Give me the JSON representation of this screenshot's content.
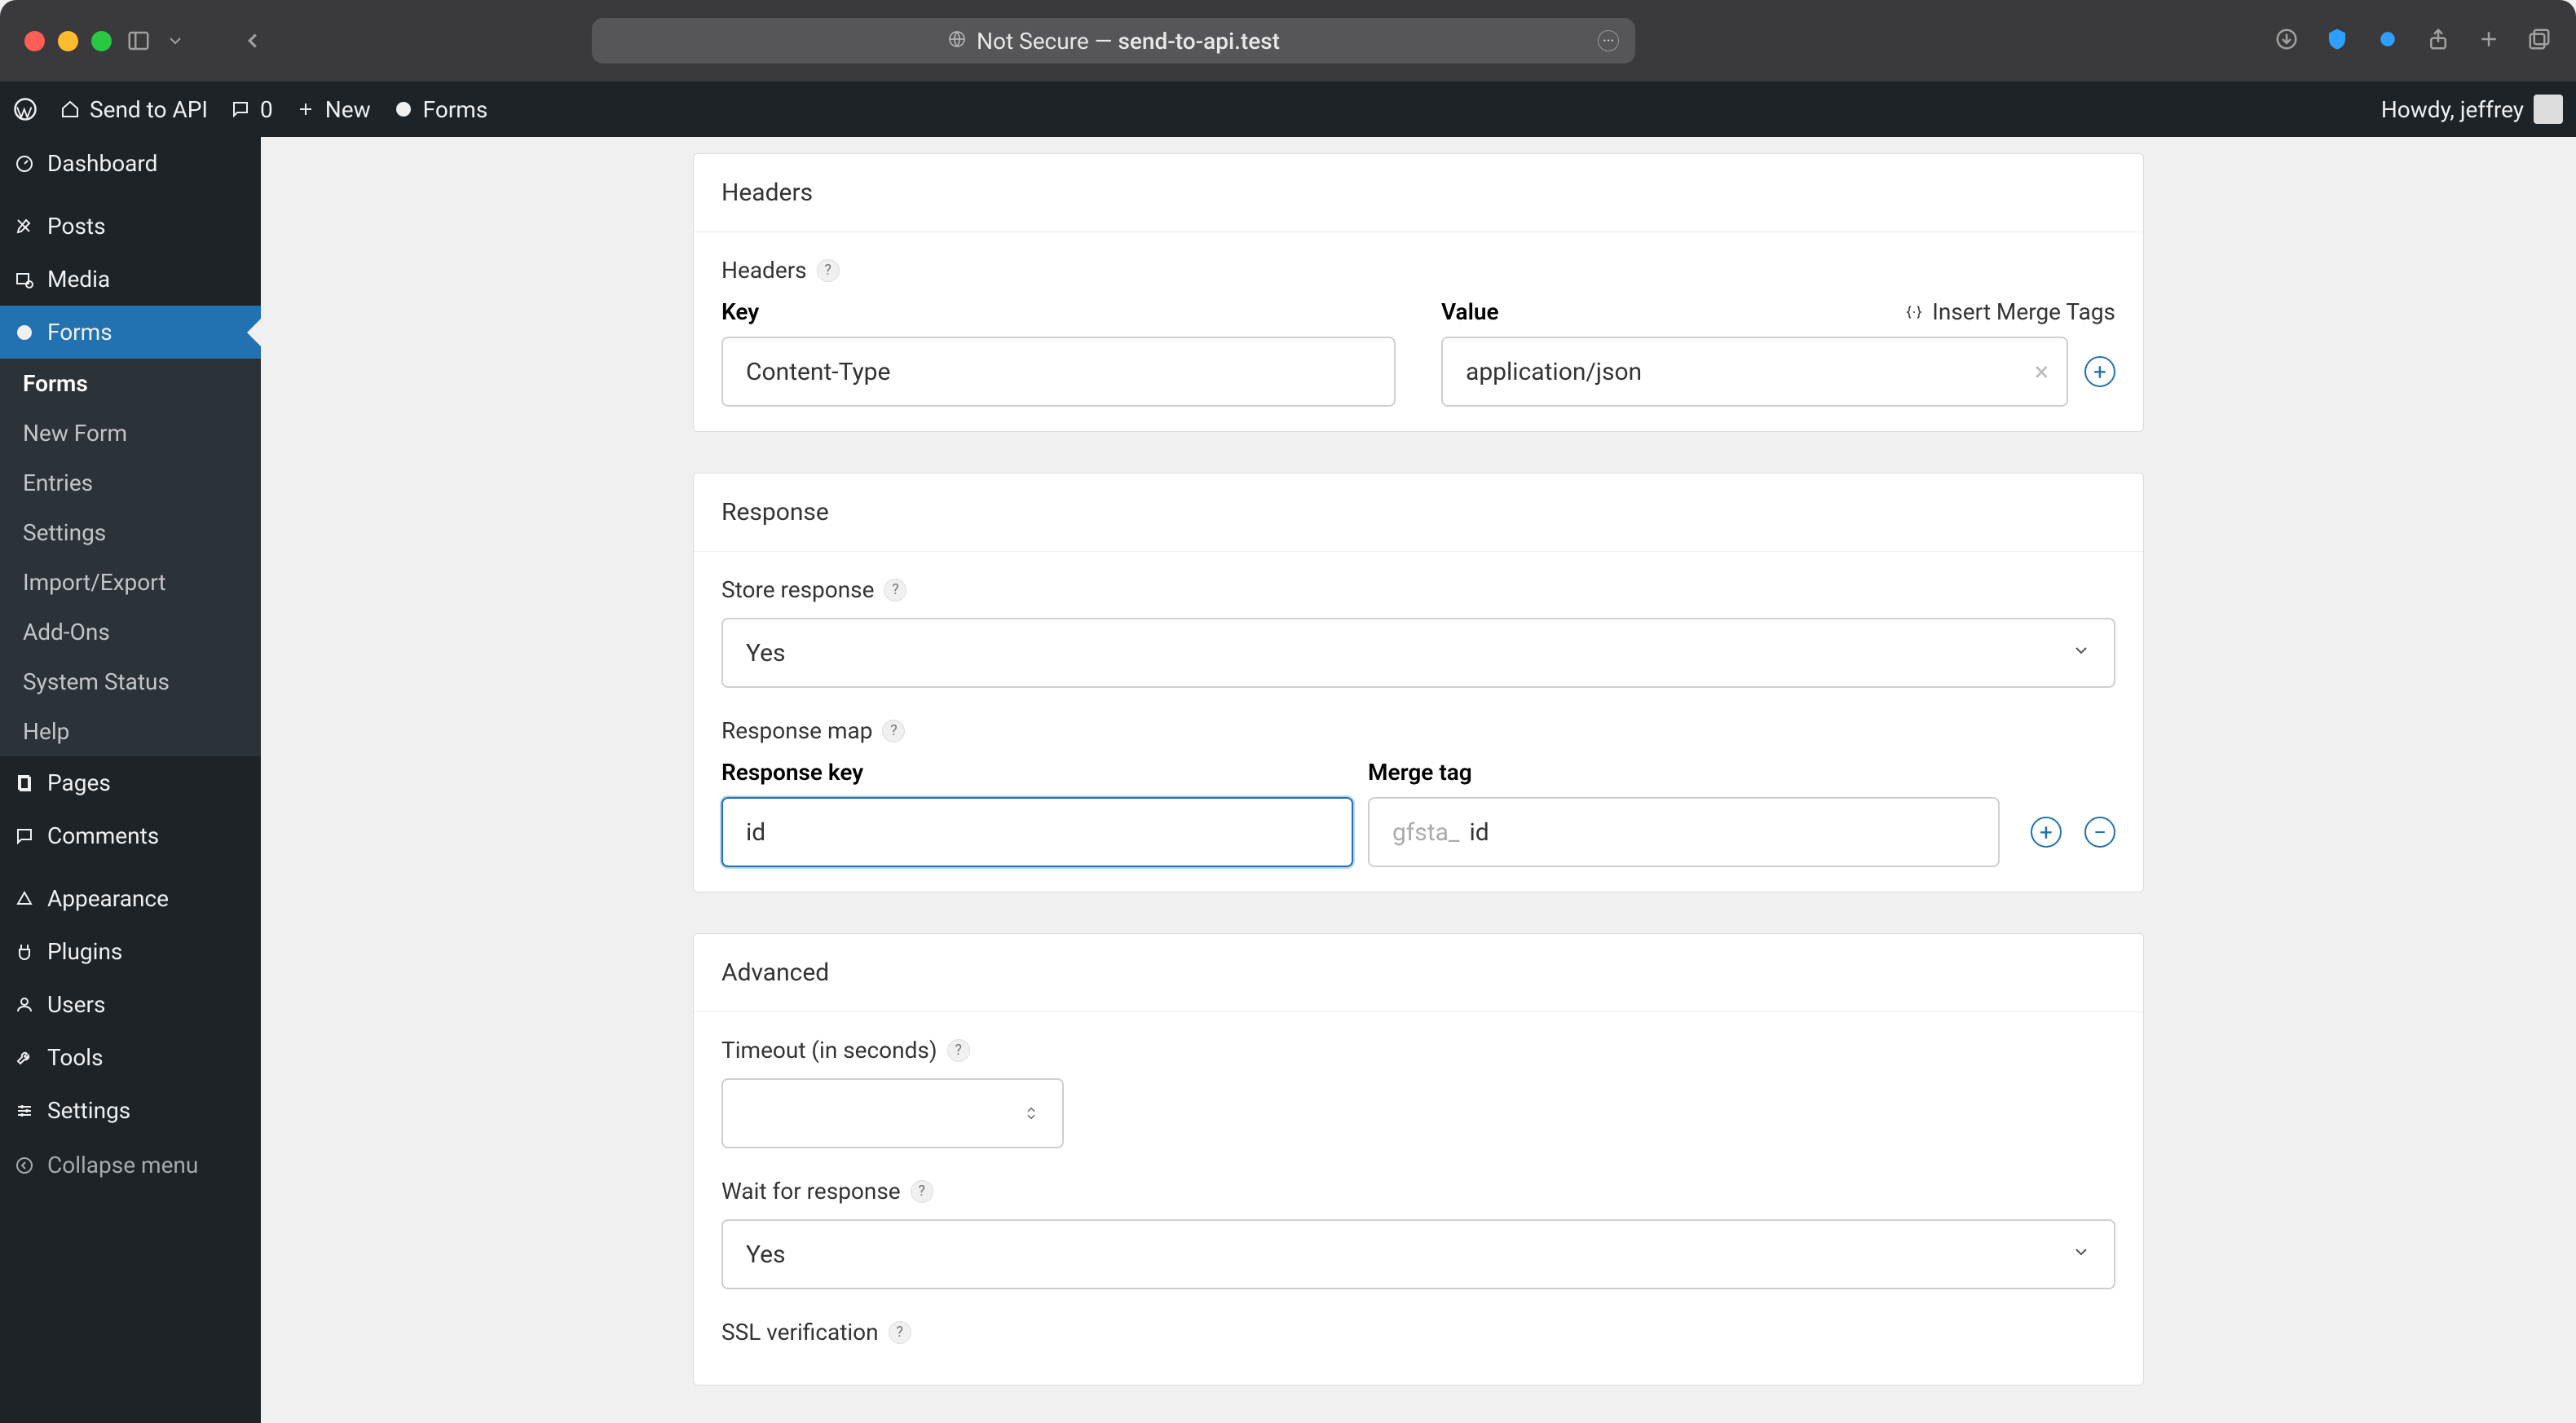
{
  "chrome": {
    "url_prefix": "Not Secure — ",
    "url": "send-to-api.test"
  },
  "wpbar": {
    "site": "Send to API",
    "comments": "0",
    "new": "New",
    "forms": "Forms",
    "howdy": "Howdy, jeffrey"
  },
  "sidebar": {
    "dashboard": "Dashboard",
    "posts": "Posts",
    "media": "Media",
    "forms": "Forms",
    "sub": {
      "forms": "Forms",
      "new_form": "New Form",
      "entries": "Entries",
      "settings": "Settings",
      "import_export": "Import/Export",
      "addons": "Add-Ons",
      "system_status": "System Status",
      "help": "Help"
    },
    "pages": "Pages",
    "comments": "Comments",
    "appearance": "Appearance",
    "plugins": "Plugins",
    "users": "Users",
    "tools": "Tools",
    "settings": "Settings",
    "collapse": "Collapse menu"
  },
  "headers": {
    "title": "Headers",
    "label": "Headers",
    "key_label": "Key",
    "value_label": "Value",
    "insert_tags": "Insert Merge Tags",
    "key_value": "Content-Type",
    "value_value": "application/json"
  },
  "response": {
    "title": "Response",
    "store_label": "Store response",
    "store_value": "Yes",
    "map_label": "Response map",
    "resp_key_label": "Response key",
    "merge_tag_label": "Merge tag",
    "resp_key_value": "id",
    "merge_prefix": "gfsta_",
    "merge_value": "id"
  },
  "advanced": {
    "title": "Advanced",
    "timeout_label": "Timeout (in seconds)",
    "timeout_value": "",
    "wait_label": "Wait for response",
    "wait_value": "Yes",
    "ssl_label": "SSL verification"
  }
}
